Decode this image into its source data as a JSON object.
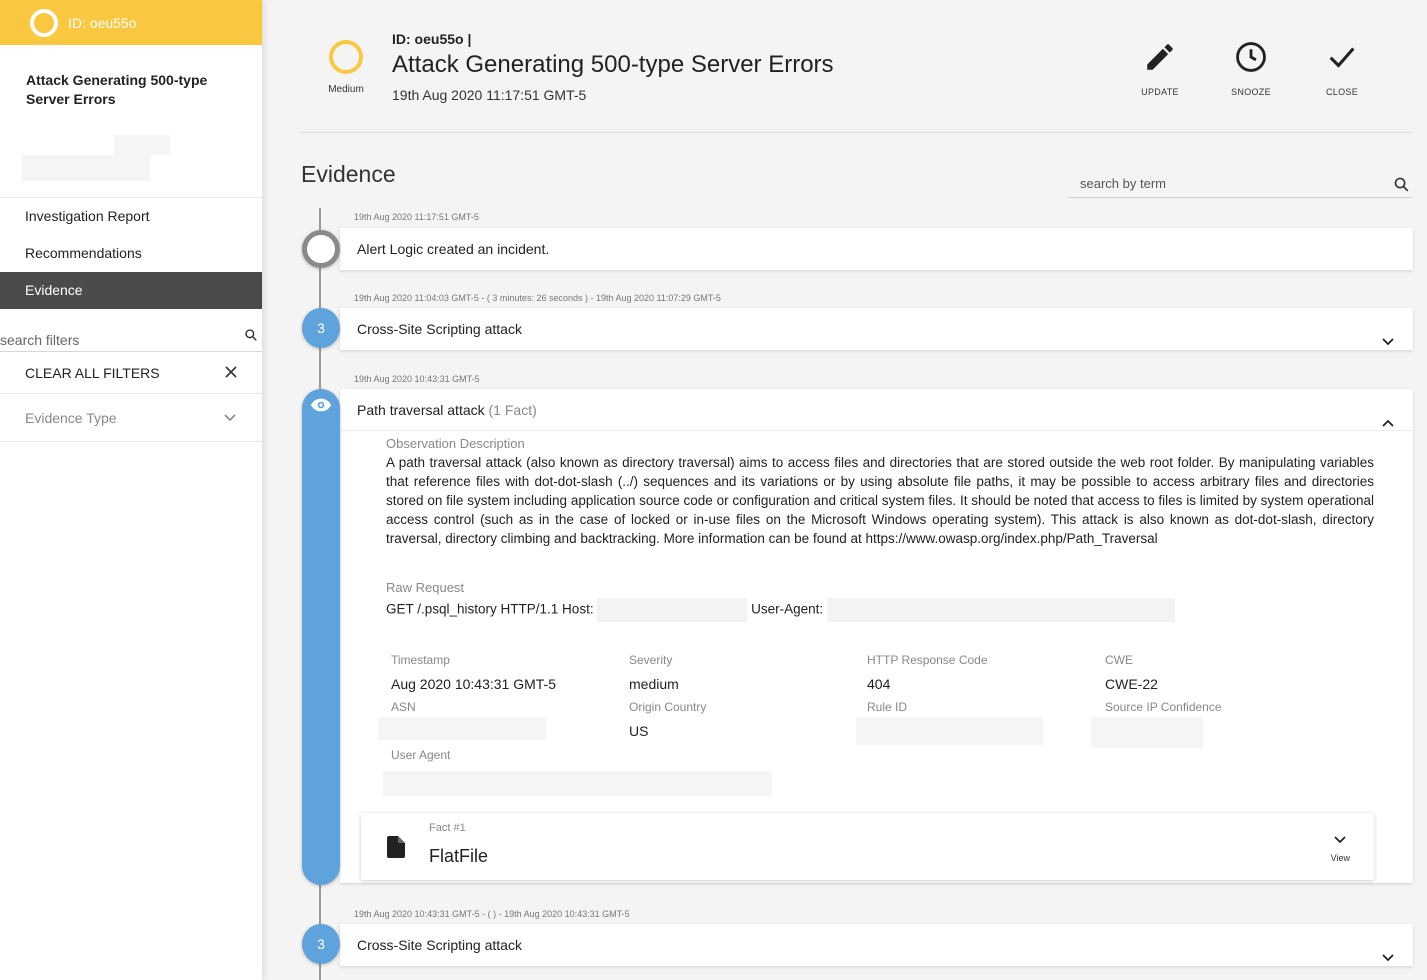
{
  "sidebar": {
    "id_label": "ID: oeu55o",
    "incident_title": "Attack Generating 500-type Server Errors",
    "nav": [
      "Investigation Report",
      "Recommendations",
      "Evidence"
    ],
    "active_nav": "Evidence",
    "search_placeholder": "search filters",
    "clear_filters": "CLEAR ALL FILTERS",
    "filter_group": "Evidence Type"
  },
  "header": {
    "severity": "Medium",
    "id_label": "ID: oeu55o |",
    "title": "Attack Generating 500-type Server Errors",
    "date": "19th Aug 2020 11:17:51 GMT-5",
    "actions": [
      "UPDATE",
      "SNOOZE",
      "CLOSE"
    ]
  },
  "evidence": {
    "title": "Evidence",
    "search_placeholder": "search by term",
    "items": [
      {
        "timestamp": "19th Aug 2020 11:17:51 GMT-5",
        "text": "Alert Logic created an incident."
      },
      {
        "timestamp": "19th Aug 2020 11:04:03 GMT-5 - ( 3 minutes: 26 seconds ) - 19th Aug 2020 11:07:29 GMT-5",
        "count": "3",
        "text": "Cross-Site Scripting attack"
      },
      {
        "timestamp": "19th Aug 2020 10:43:31 GMT-5",
        "text": "Path traversal attack",
        "fact_count": "(1 Fact)"
      },
      {
        "timestamp": "19th Aug 2020 10:43:31 GMT-5 - ( ) - 19th Aug 2020 10:43:31 GMT-5",
        "count": "3",
        "text": "Cross-Site Scripting attack"
      }
    ],
    "detail": {
      "desc_label": "Observation Description",
      "description": "A path traversal attack (also known as directory traversal) aims to access files and directories that are stored outside the web root folder. By manipulating variables that reference files with dot-dot-slash (../) sequences and its variations or by using absolute file paths, it may be possible to access arbitrary files and directories stored on file system including application source code or configuration and critical system files. It should be noted that access to files is limited by system operational access control (such as in the case of locked or in-use files on the Microsoft Windows operating system). This attack is also known as dot-dot-slash, directory traversal, directory climbing and backtracking. More information can be found at https://www.owasp.org/index.php/Path_Traversal",
      "raw_label": "Raw Request",
      "raw_prefix": "GET /.psql_history HTTP/1.1 Host:",
      "raw_ua": "User-Agent:",
      "fields": {
        "timestamp_label": "Timestamp",
        "timestamp": "Aug 2020 10:43:31 GMT-5",
        "severity_label": "Severity",
        "severity": "medium",
        "http_label": "HTTP Response Code",
        "http": "404",
        "cwe_label": "CWE",
        "cwe": "CWE-22",
        "asn_label": "ASN",
        "country_label": "Origin Country",
        "country": "US",
        "rule_label": "Rule ID",
        "source_conf_label": "Source IP Confidence",
        "ua_label": "User Agent"
      },
      "fact": {
        "label": "Fact #1",
        "name": "FlatFile",
        "view": "View"
      }
    }
  },
  "colors": {
    "accent_yellow": "#f9c740",
    "timeline_blue": "#5ea3db",
    "nav_active": "#4b4b4b"
  }
}
